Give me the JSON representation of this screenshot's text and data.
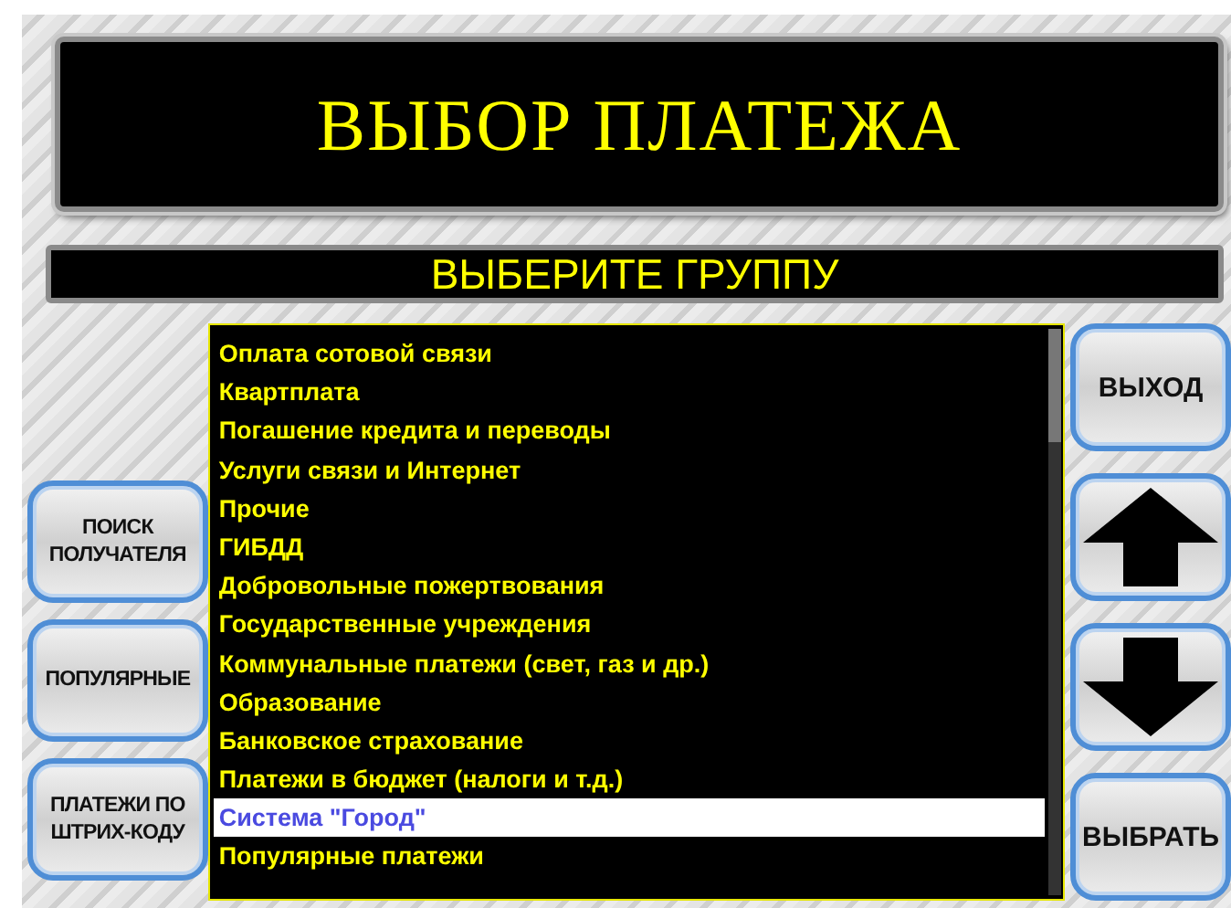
{
  "title": "ВЫБОР ПЛАТЕЖА",
  "subtitle": "ВЫБЕРИТЕ ГРУППУ",
  "left_buttons": [
    {
      "label": "ПОИСК ПОЛУЧАТЕЛЯ"
    },
    {
      "label": "ПОПУЛЯРНЫЕ"
    },
    {
      "label": "ПЛАТЕЖИ ПО ШТРИХ-КОДУ"
    }
  ],
  "groups": [
    {
      "label": "Оплата сотовой связи",
      "selected": false
    },
    {
      "label": "Квартплата",
      "selected": false
    },
    {
      "label": "Погашение кредита и переводы",
      "selected": false
    },
    {
      "label": "Услуги связи и Интернет",
      "selected": false
    },
    {
      "label": "Прочие",
      "selected": false
    },
    {
      "label": "ГИБДД",
      "selected": false
    },
    {
      "label": "Добровольные пожертвования",
      "selected": false
    },
    {
      "label": "Государственные учреждения",
      "selected": false
    },
    {
      "label": "Коммунальные платежи (свет, газ и др.)",
      "selected": false
    },
    {
      "label": "Образование",
      "selected": false
    },
    {
      "label": "Банковское страхование",
      "selected": false
    },
    {
      "label": "Платежи в бюджет (налоги и т.д.)",
      "selected": false
    },
    {
      "label": "Система \"Город\"",
      "selected": true
    },
    {
      "label": "Популярные платежи",
      "selected": false
    }
  ],
  "right_buttons": [
    {
      "kind": "text",
      "label": "ВЫХОД"
    },
    {
      "kind": "up"
    },
    {
      "kind": "down"
    },
    {
      "kind": "text",
      "label": "ВЫБРАТЬ"
    }
  ]
}
